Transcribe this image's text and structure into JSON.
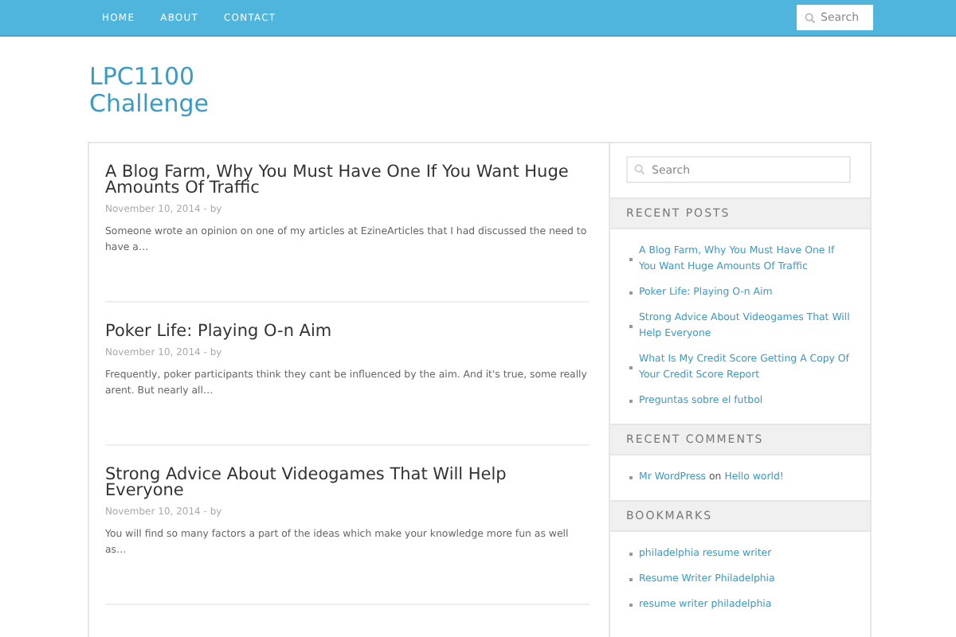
{
  "nav": {
    "items": [
      "HOME",
      "ABOUT",
      "CONTACT"
    ],
    "search": {
      "placeholder": "Search"
    }
  },
  "site_title": [
    "LPC1100",
    "Challenge"
  ],
  "posts": [
    {
      "title": "A Blog Farm, Why You Must Have One If You Want Huge Amounts Of Traffic",
      "meta": "November 10, 2014 - by",
      "excerpt": "Someone wrote an opinion on one of my articles at EzineArticles that I had discussed the need to have a…"
    },
    {
      "title": "Poker Life: Playing O-n Aim",
      "meta": "November 10, 2014 - by",
      "excerpt": "Frequently, poker participants think they cant be influenced by the aim. And it's true, some really arent. But nearly all…"
    },
    {
      "title": "Strong Advice About Videogames That Will Help Everyone",
      "meta": "November 10, 2014 - by",
      "excerpt": "You will find so many factors a part of the ideas which make your knowledge more fun as well as…"
    }
  ],
  "sidebar": {
    "search": {
      "placeholder": "Search"
    },
    "recent_posts": {
      "heading": "RECENT POSTS",
      "items": [
        "A Blog Farm, Why You Must Have One If You Want Huge Amounts Of Traffic",
        "Poker Life: Playing O-n Aim",
        "Strong Advice About Videogames That Will Help Everyone",
        "What Is My Credit Score Getting A Copy Of Your Credit Score Report",
        "Preguntas sobre el futbol"
      ]
    },
    "recent_comments": {
      "heading": "RECENT COMMENTS",
      "items": [
        {
          "author": "Mr WordPress",
          "on": "on",
          "post": "Hello world!"
        }
      ]
    },
    "bookmarks": {
      "heading": "BOOKMARKS",
      "items": [
        "philadelphia resume writer",
        "Resume Writer Philadelphia",
        "resume writer philadelphia"
      ]
    }
  }
}
